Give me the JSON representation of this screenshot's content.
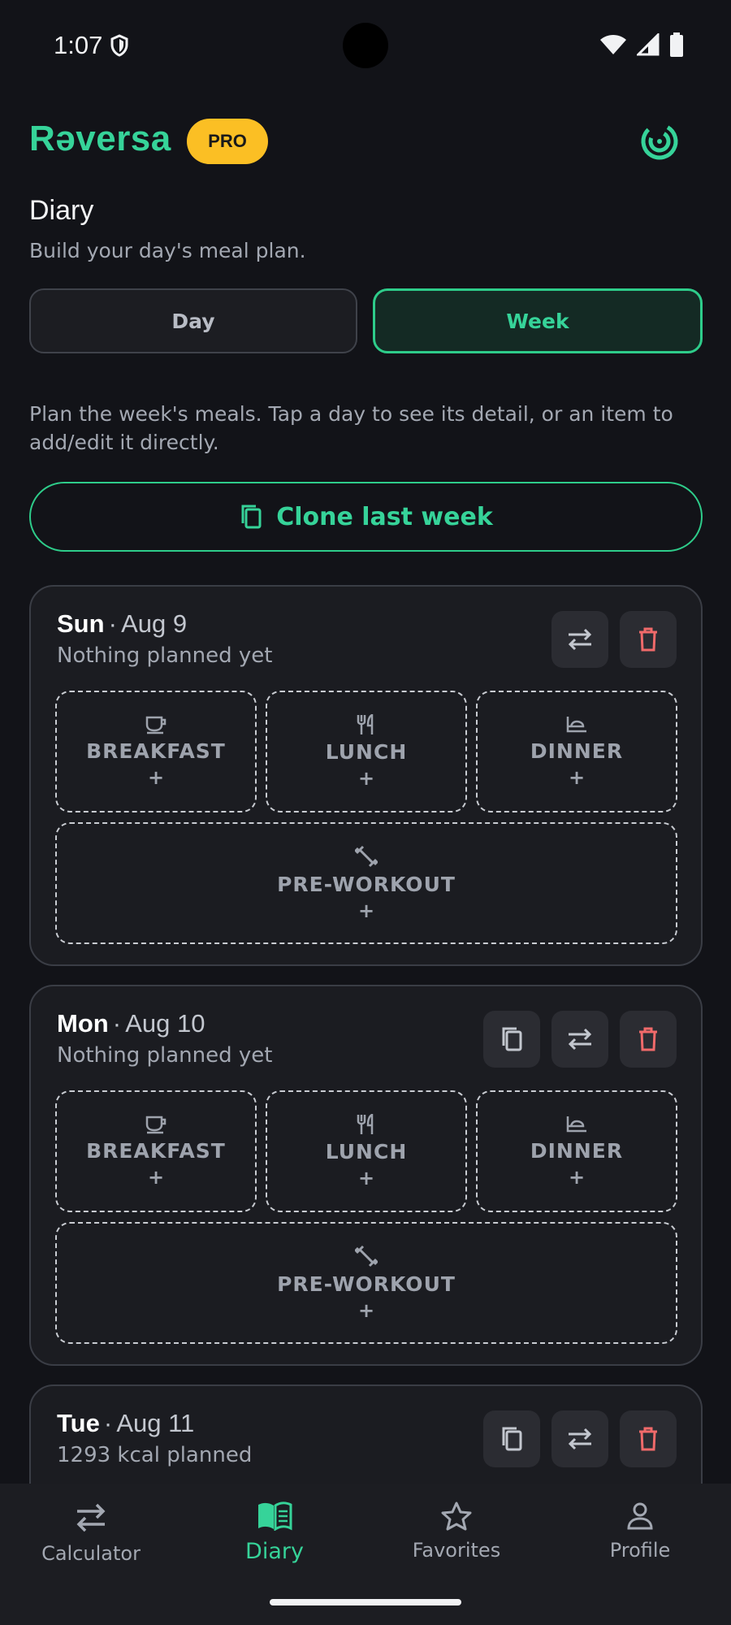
{
  "status_bar": {
    "time": "1:07"
  },
  "header": {
    "brand": "Rəversa",
    "badge": "PRO"
  },
  "page": {
    "title": "Diary",
    "subtitle": "Build your day's meal plan.",
    "tabs": {
      "day": "Day",
      "week": "Week",
      "selected": "Week"
    },
    "description": "Plan the week's meals. Tap a day to see its detail, or an item to add/edit it directly.",
    "clone_label": "Clone last week"
  },
  "days": [
    {
      "name": "Sun",
      "date": "Aug 9",
      "status": "Nothing planned yet",
      "slots": [
        {
          "label": "BREAKFAST",
          "icon": "coffee-cup-icon",
          "plus": "+"
        },
        {
          "label": "LUNCH",
          "icon": "fork-knife-icon",
          "plus": "+"
        },
        {
          "label": "DINNER",
          "icon": "plate-icon",
          "plus": "+"
        },
        {
          "label": "PRE-WORKOUT",
          "icon": "dumbbell-icon",
          "plus": "+"
        }
      ]
    },
    {
      "name": "Mon",
      "date": "Aug 10",
      "status": "Nothing planned yet",
      "slots": [
        {
          "label": "BREAKFAST",
          "icon": "coffee-cup-icon",
          "plus": "+"
        },
        {
          "label": "LUNCH",
          "icon": "fork-knife-icon",
          "plus": "+"
        },
        {
          "label": "DINNER",
          "icon": "plate-icon",
          "plus": "+"
        },
        {
          "label": "PRE-WORKOUT",
          "icon": "dumbbell-icon",
          "plus": "+"
        }
      ]
    },
    {
      "name": "Tue",
      "date": "Aug 11",
      "status": "1293 kcal planned"
    }
  ],
  "separator": "·",
  "nav": [
    {
      "label": "Calculator",
      "icon": "swap-arrows-icon",
      "active": false
    },
    {
      "label": "Diary",
      "icon": "book-icon",
      "active": true
    },
    {
      "label": "Favorites",
      "icon": "star-icon",
      "active": false
    },
    {
      "label": "Profile",
      "icon": "person-icon",
      "active": false
    }
  ],
  "colors": {
    "accent": "#36d399",
    "badge": "#fbbf24",
    "delete": "#f06a6a",
    "background": "#121318",
    "card": "#1b1c21"
  }
}
